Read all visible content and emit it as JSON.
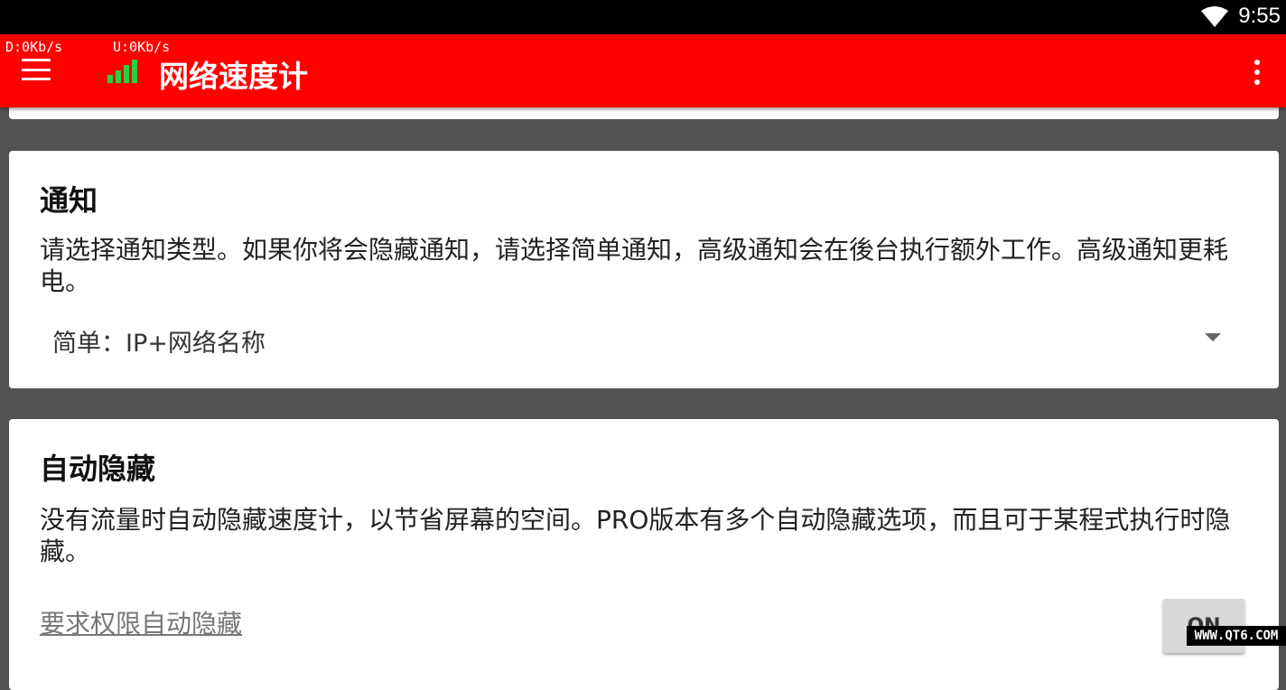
{
  "status_bar": {
    "time": "9:55",
    "wifi_icon": "wifi-icon"
  },
  "app_bar": {
    "download_speed": "D:0Kb/s",
    "upload_speed": "U:0Kb/s",
    "title": "网络速度计",
    "menu_icon": "hamburger-menu-icon",
    "app_icon": "signal-bars-icon",
    "overflow_icon": "more-vert-icon",
    "color": "#ff0000"
  },
  "notification_card": {
    "title": "通知",
    "description": "请选择通知类型。如果你将会隐藏通知，请选择简单通知，高级通知会在後台执行额外工作。高级通知更耗电。",
    "selected_option": "简单：IP+网络名称"
  },
  "autohide_card": {
    "title": "自动隐藏",
    "description": "没有流量时自动隐藏速度计，以节省屏幕的空间。PRO版本有多个自动隐藏选项，而且可于某程式执行时隐藏。",
    "permission_link": "要求权限自动隐藏",
    "toggle_label": "ON"
  },
  "watermark": "WWW.QT6.COM"
}
